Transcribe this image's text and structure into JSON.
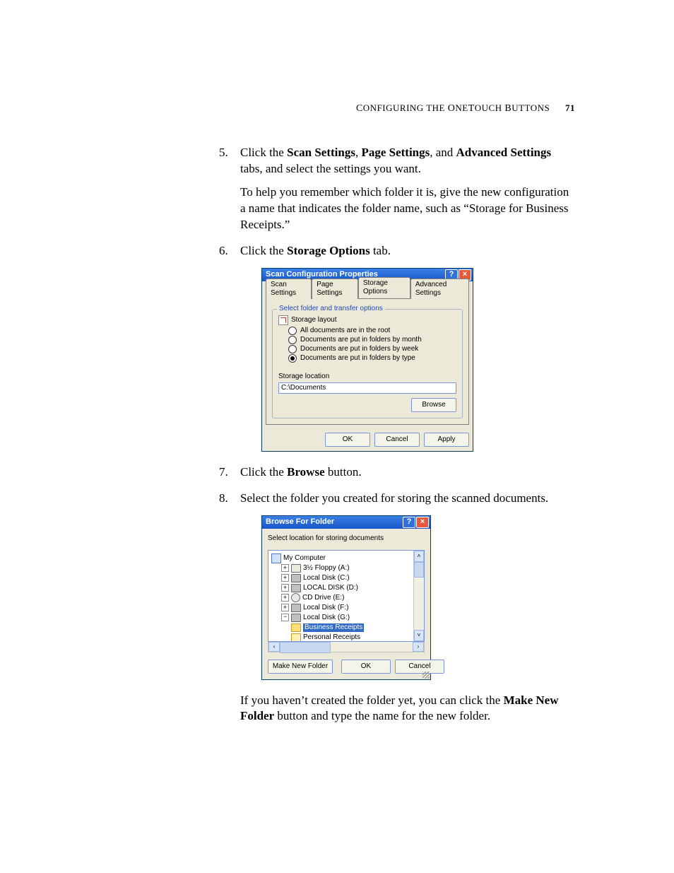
{
  "header": {
    "section": "Configuring the OneTouch Buttons",
    "page_number": "71"
  },
  "steps": {
    "s5": {
      "num": "5.",
      "pre": "Click the ",
      "b1": "Scan Settings",
      "mid1": ", ",
      "b2": "Page Settings",
      "mid2": ", and ",
      "b3": "Advanced Settings",
      "post": " tabs, and select the settings you want.",
      "para2": "To help you remember which folder it is, give the new configuration a name that indicates the folder name, such as “Storage for Business Receipts.”"
    },
    "s6": {
      "num": "6.",
      "pre": "Click the ",
      "b1": "Storage Options",
      "post": " tab."
    },
    "s7": {
      "num": "7.",
      "pre": "Click the ",
      "b1": "Browse",
      "post": " button."
    },
    "s8": {
      "num": "8.",
      "text": "Select the folder you created for storing the scanned documents."
    },
    "closing": {
      "pre": "If you haven’t created the folder yet, you can click the ",
      "b1": "Make New Folder",
      "post": " button and type the name for the new folder."
    }
  },
  "scp": {
    "title": "Scan Configuration Properties",
    "tabs": {
      "scan": "Scan Settings",
      "page": "Page Settings",
      "storage": "Storage Options",
      "advanced": "Advanced Settings"
    },
    "group_legend": "Select folder and transfer options",
    "storage_layout_label": "Storage layout",
    "radios": {
      "r1": "All documents are in the root",
      "r2": "Documents are put in folders by month",
      "r3": "Documents are put in folders by week",
      "r4": "Documents are put in folders by type"
    },
    "storage_location_label": "Storage location",
    "path": "C:\\Documents",
    "browse": "Browse",
    "ok": "OK",
    "cancel": "Cancel",
    "apply": "Apply"
  },
  "bff": {
    "title": "Browse For Folder",
    "subtitle": "Select location for storing documents",
    "tree": {
      "my_computer": "My Computer",
      "floppy": "3½ Floppy (A:)",
      "c": "Local Disk (C:)",
      "d": "LOCAL DISK (D:)",
      "e": "CD Drive (E:)",
      "f": "Local Disk (F:)",
      "g": "Local Disk (G:)",
      "business": "Business Receipts",
      "personal": "Personal Receipts"
    },
    "make_new": "Make New Folder",
    "ok": "OK",
    "cancel": "Cancel"
  }
}
